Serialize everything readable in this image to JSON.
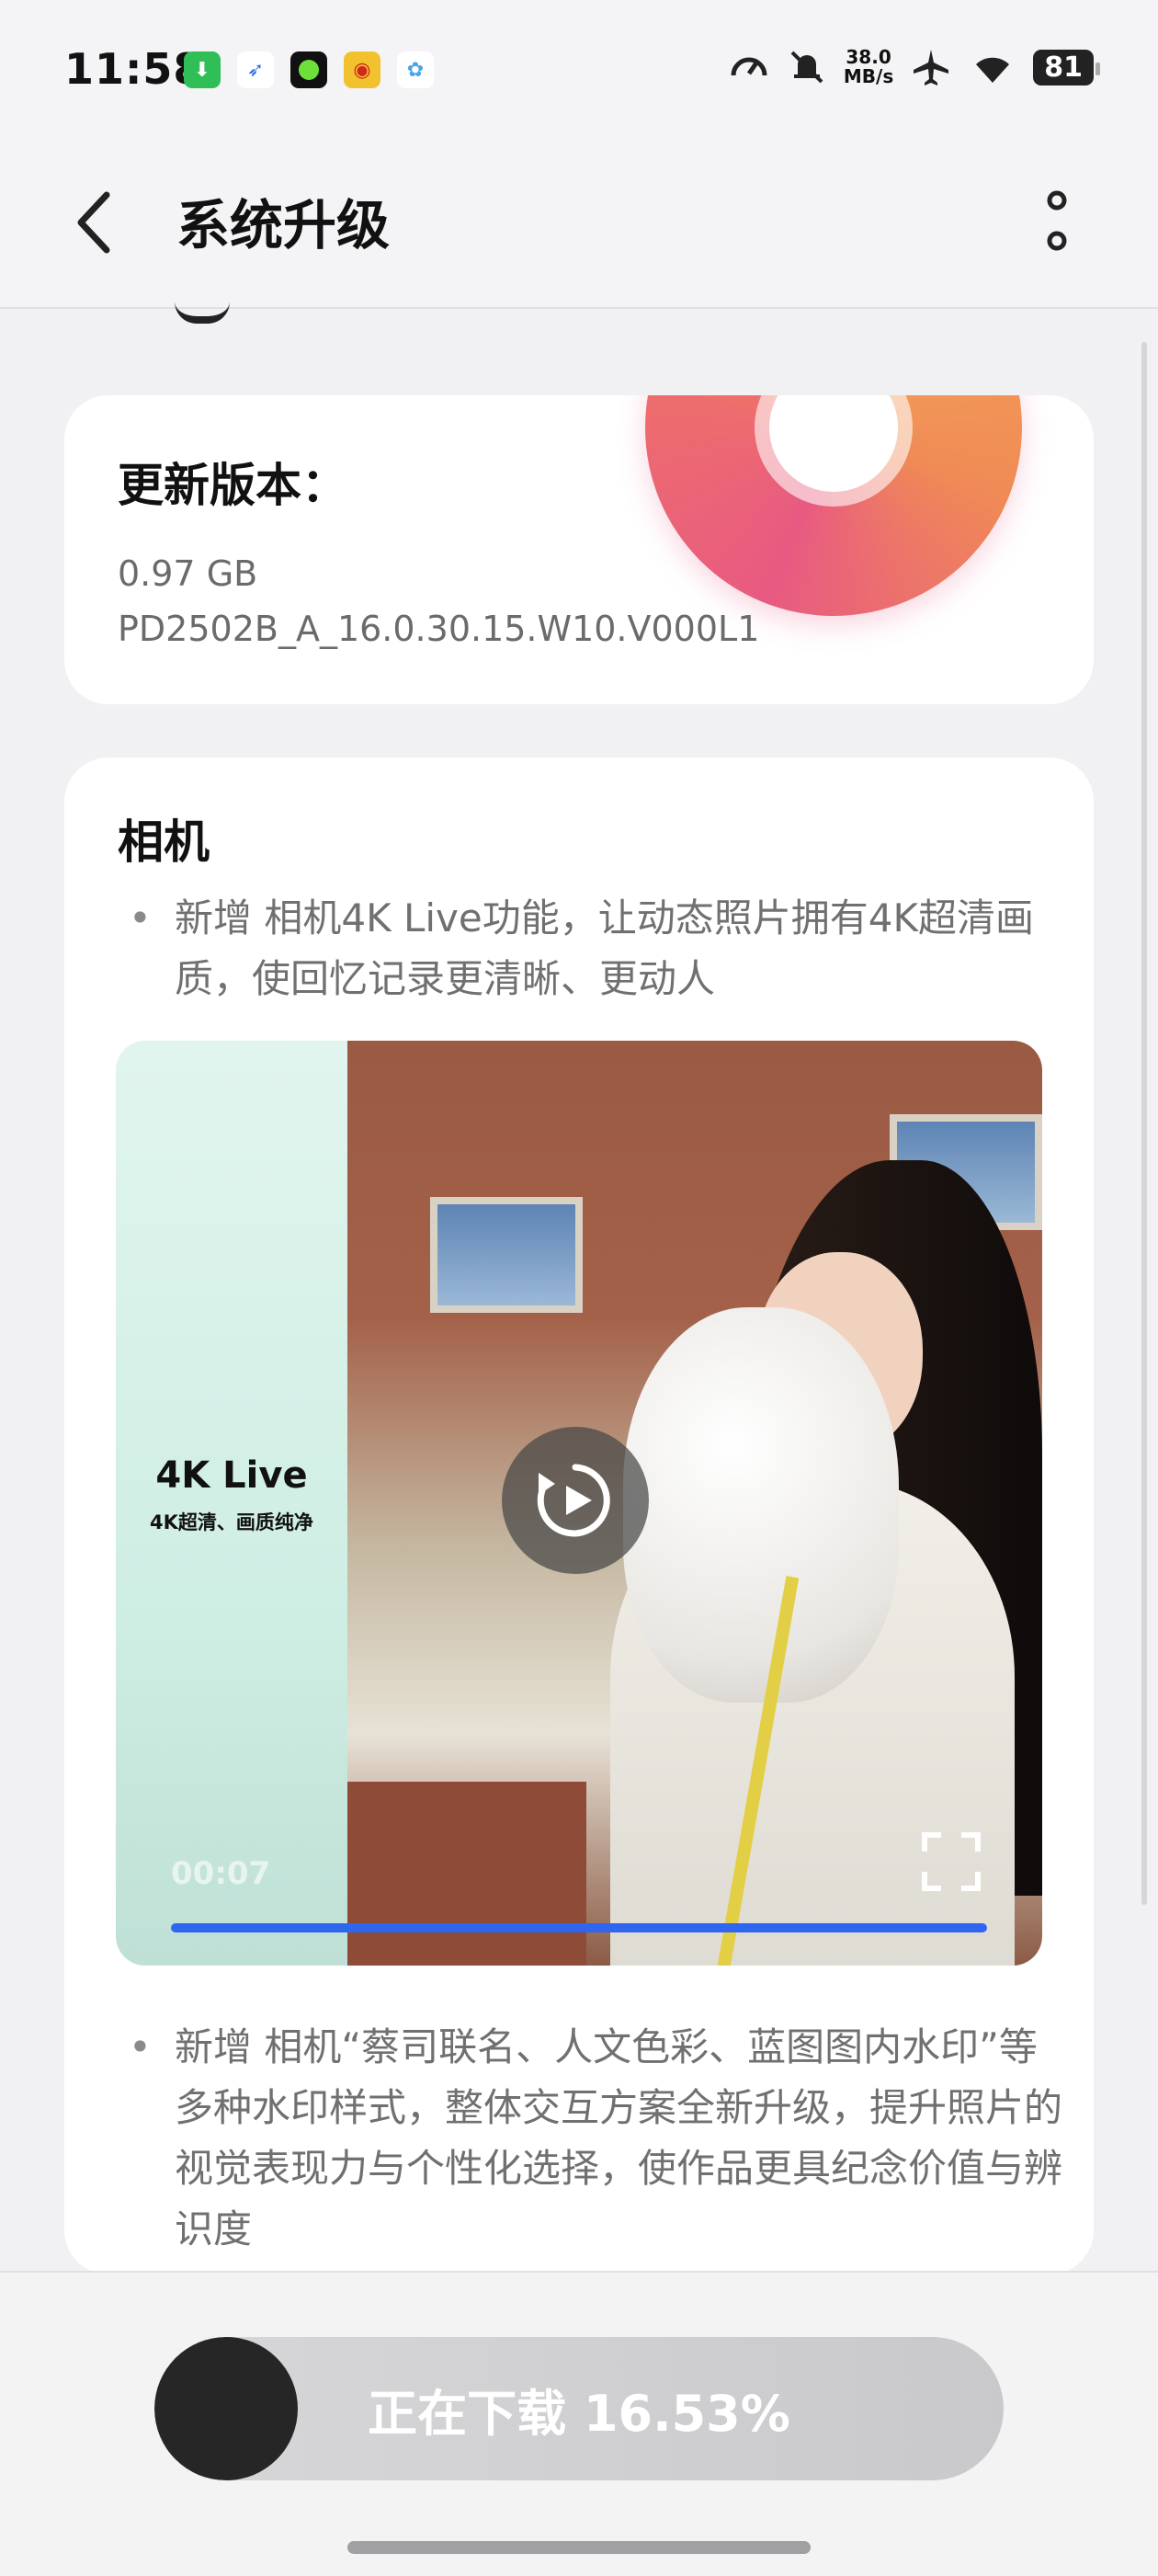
{
  "status_bar": {
    "time": "11:58",
    "network_speed_value": "38.0",
    "network_speed_unit": "MB/s",
    "battery_level": "81",
    "app_icons": [
      "download-app-icon",
      "bird-app-icon",
      "green-dot-app-icon",
      "weibo-icon",
      "cloud-app-icon"
    ],
    "system_icons": [
      "speedometer-icon",
      "mute-bell-icon",
      "airplane-icon",
      "wifi-icon",
      "battery-icon"
    ]
  },
  "header": {
    "title": "系统升级"
  },
  "update_card": {
    "title": "更新版本：",
    "size": "0.97 GB",
    "version": "PD2502B_A_16.0.30.15.W10.V000L1"
  },
  "camera_section": {
    "title": "相机",
    "bullets": [
      "新增 相机4K Live功能，让动态照片拥有4K超清画质，使回忆记录更清晰、更动人",
      "新增 相机“蔡司联名、人文色彩、蓝图图内水印”等多种水印样式，整体交互方案全新升级，提升照片的视觉表现力与个性化选择，使作品更具纪念价值与辨识度"
    ],
    "video": {
      "title": "4K Live",
      "subtitle": "4K超清、画质纯净",
      "time_display": "00:07",
      "progress": 1.0
    }
  },
  "download": {
    "label": "正在下载 16.53%",
    "progress": 0.1653
  },
  "colors": {
    "accent": "#2e66f0",
    "download_fill": "#262626",
    "background": "#f1f1f3"
  }
}
